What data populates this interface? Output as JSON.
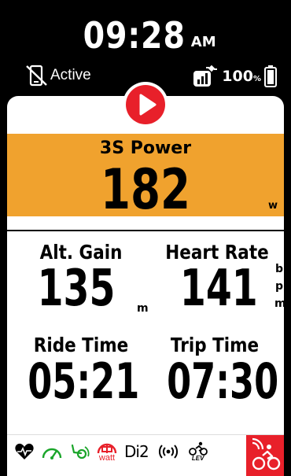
{
  "header": {
    "time": "09:28",
    "ampm": "AM",
    "phone_status": "Active",
    "battery_percent": "100",
    "battery_unit": "%"
  },
  "power": {
    "label": "3S Power",
    "value": "182",
    "unit": "w"
  },
  "fields": {
    "alt_gain": {
      "label": "Alt. Gain",
      "value": "135",
      "unit": "m"
    },
    "heart_rate": {
      "label": "Heart Rate",
      "value": "141",
      "unit": [
        "b",
        "p",
        "m"
      ]
    },
    "ride_time": {
      "label": "Ride Time",
      "value": "05:21"
    },
    "trip_time": {
      "label": "Trip Time",
      "value": "07:30"
    }
  },
  "sensors": {
    "power_meter_label": "watt",
    "di2_label": "Di2",
    "lev_label": "LEV"
  },
  "icons": [
    "phone-off-icon",
    "gps-signal-icon",
    "battery-icon",
    "play-icon",
    "heart-rate-icon",
    "speed-icon",
    "cadence-icon",
    "power-meter-icon",
    "di2-icon",
    "radar-icon",
    "lev-bike-icon",
    "bike-icon"
  ],
  "colors": {
    "accent_red": "#e8202a",
    "power_orange": "#f0a22e",
    "sensor_green": "#1aa52a"
  }
}
